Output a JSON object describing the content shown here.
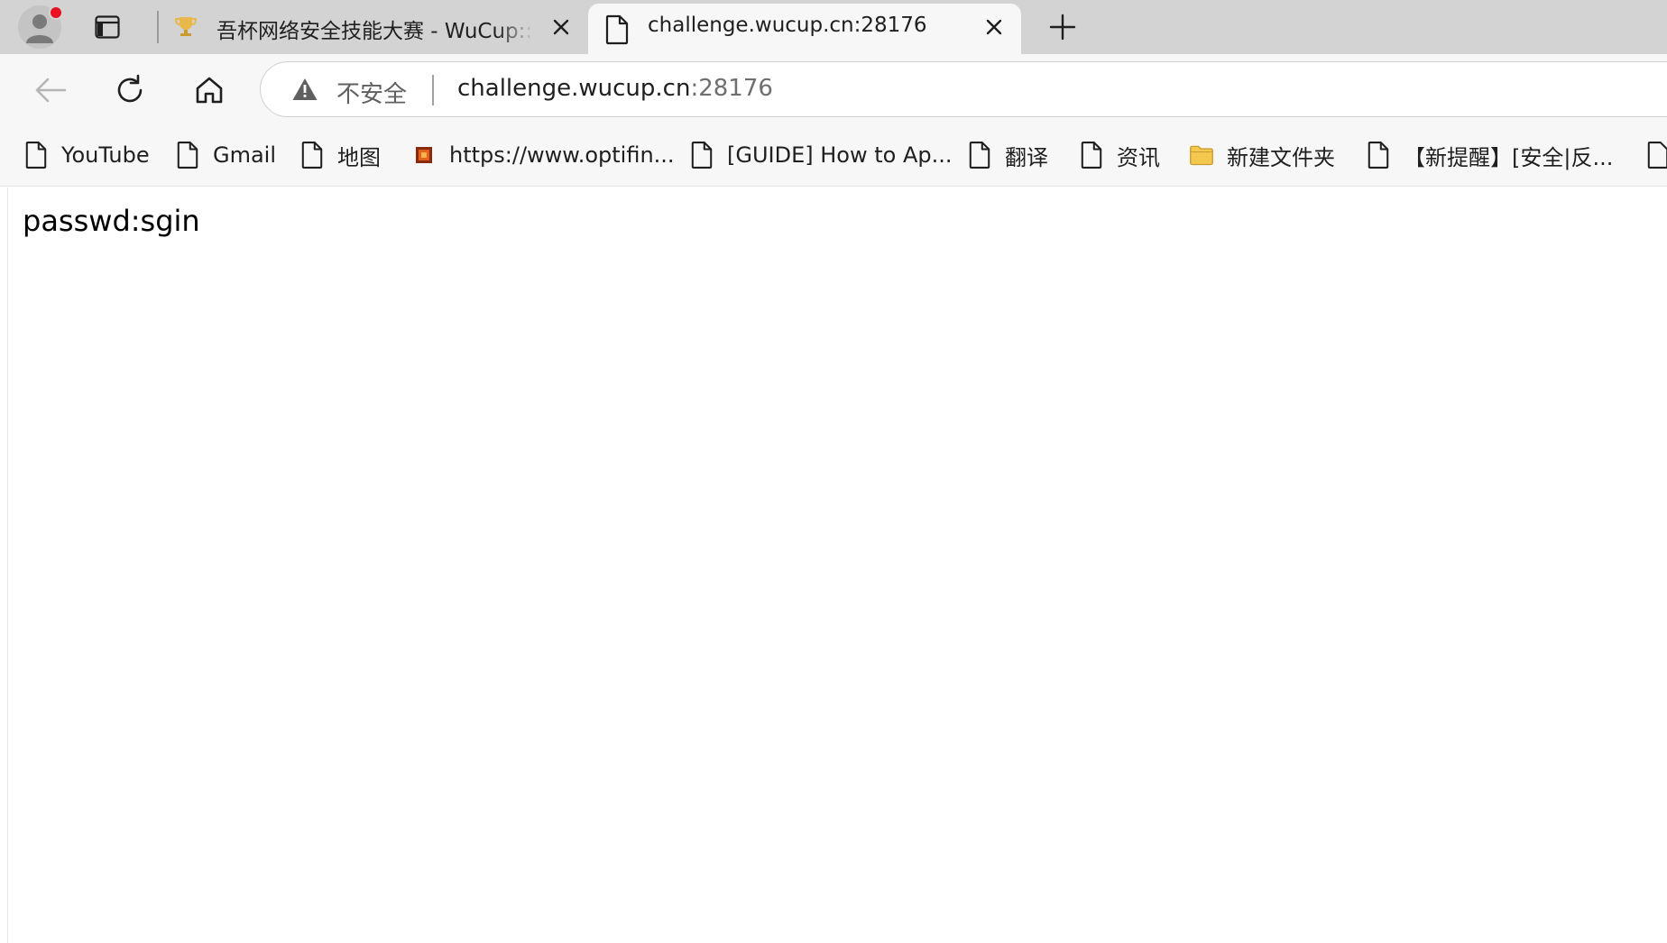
{
  "tabs": [
    {
      "title": "吾杯网络安全技能大赛 - WuCup::CTF",
      "active": false
    },
    {
      "title": "challenge.wucup.cn:28176",
      "active": true
    }
  ],
  "address_bar": {
    "security_label": "不安全",
    "host": "challenge.wucup.cn",
    "port": ":28176"
  },
  "bookmarks": [
    {
      "label": "YouTube",
      "icon": "page-icon"
    },
    {
      "label": "Gmail",
      "icon": "page-icon"
    },
    {
      "label": "地图",
      "icon": "page-icon"
    },
    {
      "label": "https://www.optifin...",
      "icon": "optifine-favicon"
    },
    {
      "label": "[GUIDE] How to Ap...",
      "icon": "page-icon"
    },
    {
      "label": "翻译",
      "icon": "page-icon"
    },
    {
      "label": "资讯",
      "icon": "page-icon"
    },
    {
      "label": "新建文件夹",
      "icon": "folder-icon"
    },
    {
      "label": "【新提醒】[安全|反...",
      "icon": "page-icon"
    }
  ],
  "page": {
    "text": "passwd:sgin"
  },
  "colors": {
    "tab_strip": "#d3d3d3",
    "toolbar": "#f7f7f7",
    "notification_dot": "#e81123",
    "folder": "#f2c94c"
  }
}
